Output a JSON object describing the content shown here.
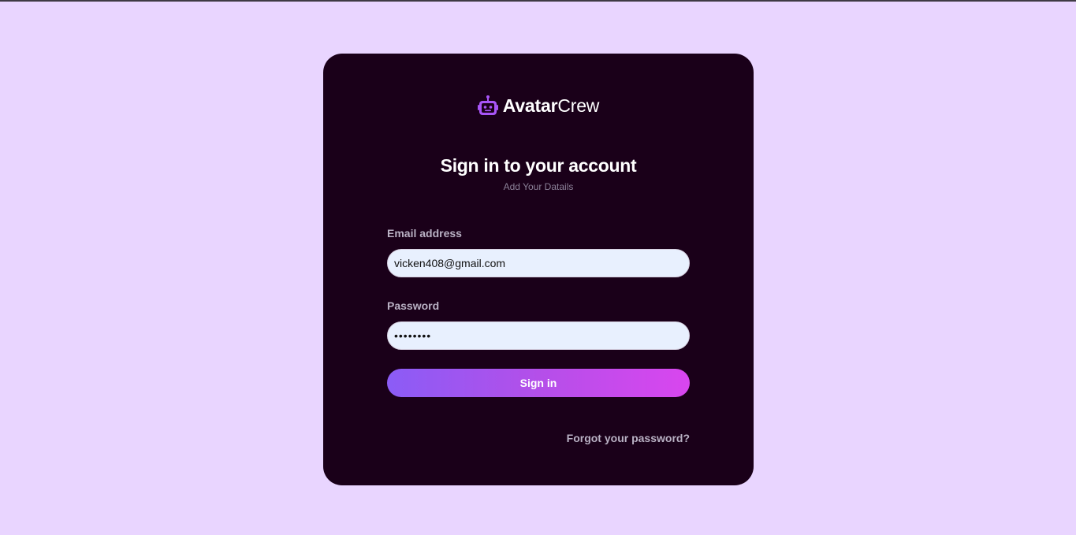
{
  "brand": {
    "name_bold": "Avatar",
    "name_light": "Crew",
    "icon": "robot-icon",
    "accent": "#a855f7"
  },
  "heading": {
    "title": "Sign in to your account",
    "subtitle": "Add Your Datails"
  },
  "form": {
    "email_label": "Email address",
    "email_value": "vicken408@gmail.com",
    "password_label": "Password",
    "password_value": "••••••••",
    "submit_label": "Sign in",
    "forgot_label": "Forgot your password?"
  },
  "colors": {
    "background": "#e9d5ff",
    "card": "#1a0019",
    "button_start": "#8b5cf6",
    "button_end": "#d946ef"
  }
}
